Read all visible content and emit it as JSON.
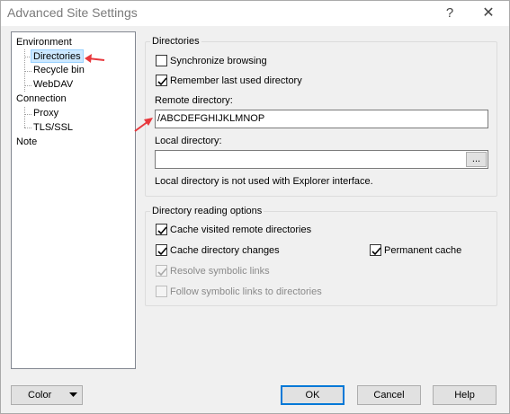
{
  "window": {
    "title": "Advanced Site Settings"
  },
  "titlebar": {
    "help_glyph": "?",
    "close_glyph": "✕"
  },
  "tree": {
    "environment": "Environment",
    "directories": "Directories",
    "recycle_bin": "Recycle bin",
    "webdav": "WebDAV",
    "connection": "Connection",
    "proxy": "Proxy",
    "tls_ssl": "TLS/SSL",
    "note": "Note",
    "selected": "Directories"
  },
  "directories_group": {
    "title": "Directories",
    "sync_browsing": {
      "label": "Synchronize browsing",
      "checked": false
    },
    "remember_last_dir": {
      "label": "Remember last used directory",
      "checked": true
    },
    "remote_dir_label": "Remote directory:",
    "remote_dir_value": "/ABCDEFGHIJKLMNOP",
    "local_dir_label": "Local directory:",
    "local_dir_value": "",
    "browse_label": "...",
    "local_dir_note": "Local directory is not used with Explorer interface."
  },
  "reading_group": {
    "title": "Directory reading options",
    "cache_visited": {
      "label": "Cache visited remote directories",
      "checked": true
    },
    "cache_changes": {
      "label": "Cache directory changes",
      "checked": true
    },
    "permanent_cache": {
      "label": "Permanent cache",
      "checked": true
    },
    "resolve_symlinks": {
      "label": "Resolve symbolic links",
      "checked": true,
      "disabled": true
    },
    "follow_symlinks": {
      "label": "Follow symbolic links to directories",
      "checked": false,
      "disabled": true
    }
  },
  "buttons": {
    "color": "Color",
    "ok": "OK",
    "cancel": "Cancel",
    "help": "Help"
  },
  "colors": {
    "annotation_arrow": "#e8383d",
    "selection": "#cce8ff"
  }
}
